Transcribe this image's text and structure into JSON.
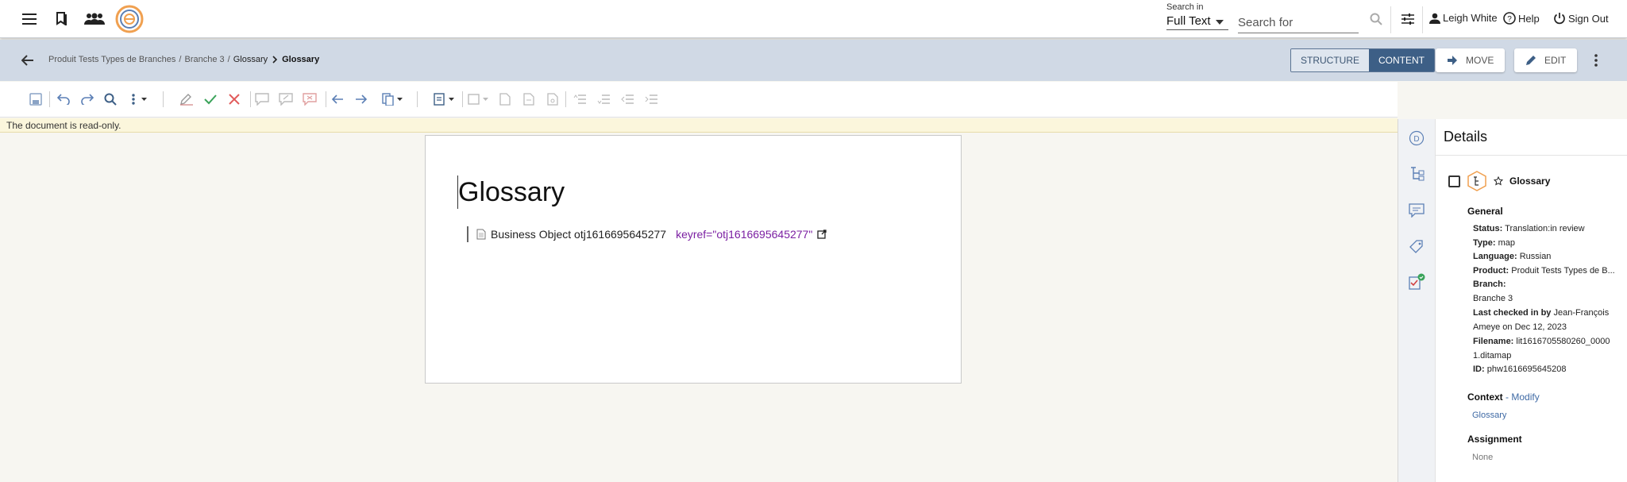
{
  "topbar": {
    "search_in_label": "Search in",
    "search_in_value": "Full Text",
    "search_placeholder": "Search for",
    "user_name": "Leigh White",
    "help_label": "Help",
    "signout_label": "Sign Out"
  },
  "subbar": {
    "breadcrumb": {
      "product": "Produit Tests Types de Branches",
      "branch": "Branche 3",
      "folder": "Glossary",
      "current": "Glossary"
    },
    "structure_label": "STRUCTURE",
    "content_label": "CONTENT",
    "move_label": "MOVE",
    "edit_label": "EDIT"
  },
  "notice": "The document is read-only.",
  "document": {
    "title": "Glossary",
    "topicref_text": "Business Object otj1616695645277",
    "keyref_text": "keyref=\"otj1616695645277\""
  },
  "details": {
    "header": "Details",
    "object_name": "Glossary",
    "general_label": "General",
    "status_label": "Status:",
    "status_value": "Translation:in review",
    "type_label": "Type:",
    "type_value": "map",
    "language_label": "Language:",
    "language_value": "Russian",
    "product_label": "Product:",
    "product_value": "Produit Tests Types de B...",
    "branch_label": "Branch:",
    "branch_value": "Branche 3",
    "checked_label": "Last checked in by",
    "checked_value_1": "Jean-François",
    "checked_value_2": "Ameye on Dec 12, 2023",
    "filename_label": "Filename:",
    "filename_value_1": "lit1616705580260_0000",
    "filename_value_2": "1.ditamap",
    "id_label": "ID:",
    "id_value": "phw1616695645208",
    "context_label": "Context",
    "context_modify": "- Modify",
    "context_value": "Glossary",
    "assignment_label": "Assignment",
    "assignment_value": "None"
  },
  "colors": {
    "subbar_bg": "#d0d9e5",
    "active_tab": "#3d5f86",
    "keyref": "#7b1fa2",
    "link": "#3f6aa5",
    "notice_bg": "#fbf6dc"
  }
}
